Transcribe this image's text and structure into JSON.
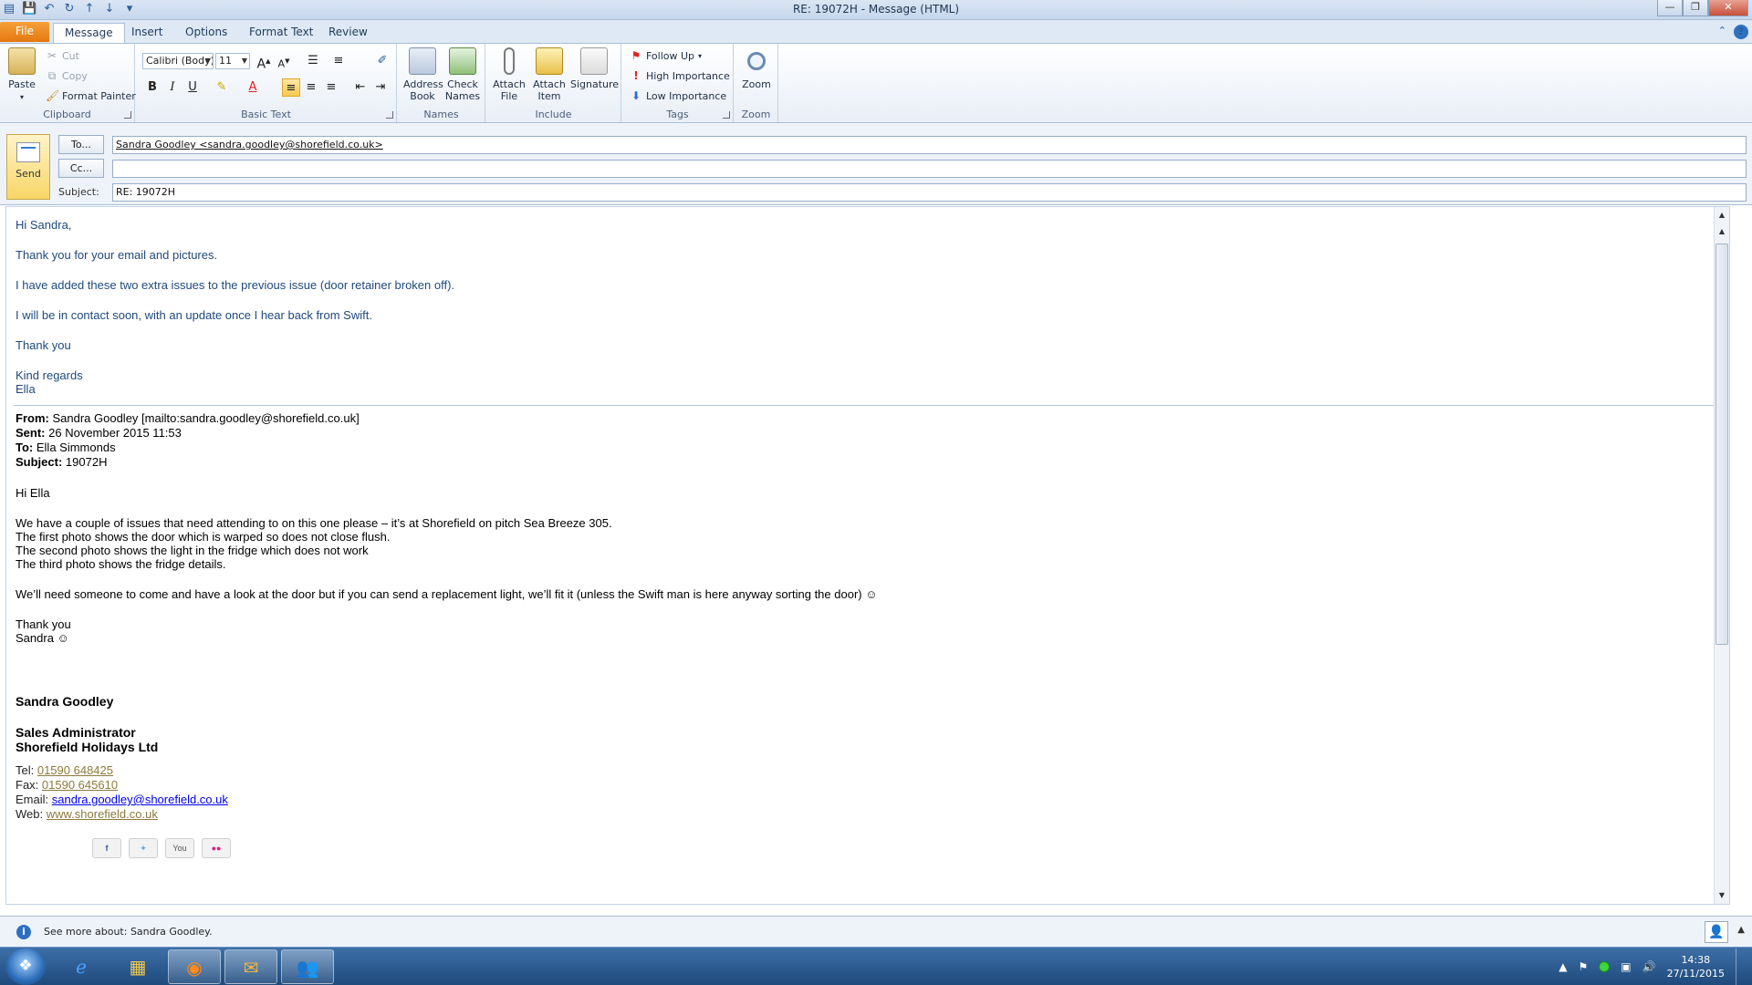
{
  "window": {
    "title": "RE: 19072H - Message (HTML)"
  },
  "tabs": [
    {
      "label": "File"
    },
    {
      "label": "Message"
    },
    {
      "label": "Insert"
    },
    {
      "label": "Options"
    },
    {
      "label": "Format Text"
    },
    {
      "label": "Review"
    }
  ],
  "ribbon": {
    "clipboard": {
      "label": "Clipboard",
      "paste": "Paste",
      "cut": "Cut",
      "copy": "Copy",
      "format_painter": "Format Painter"
    },
    "basic_text": {
      "label": "Basic Text",
      "font": "Calibri (Body)",
      "size": "11"
    },
    "names": {
      "label": "Names",
      "address_book": "Address Book",
      "check_names": "Check Names"
    },
    "include": {
      "label": "Include",
      "attach_file": "Attach File",
      "attach_item": "Attach Item",
      "signature": "Signature"
    },
    "tags": {
      "label": "Tags",
      "follow_up": "Follow Up",
      "high": "High Importance",
      "low": "Low Importance"
    },
    "zoom": {
      "label": "Zoom",
      "zoom": "Zoom"
    }
  },
  "compose": {
    "send": "Send",
    "to_btn": "To...",
    "cc_btn": "Cc...",
    "subject_lbl": "Subject:",
    "to_value": "Sandra Goodley <sandra.goodley@shorefield.co.uk>",
    "cc_value": "",
    "subject_value": "RE: 19072H"
  },
  "reply": {
    "greeting": "Hi Sandra,",
    "l1": "Thank you for your email and pictures.",
    "l2": "I have added these two extra issues to the previous issue (door retainer broken off).",
    "l3": "I will be in contact soon, with an update once I hear back from Swift.",
    "l4": "Thank you",
    "regards": "Kind regards",
    "name": "Ella"
  },
  "original": {
    "from_lbl": "From:",
    "from": "Sandra Goodley [mailto:sandra.goodley@shorefield.co.uk]",
    "sent_lbl": "Sent:",
    "sent": "26 November 2015 11:53",
    "to_lbl": "To:",
    "to": "Ella Simmonds",
    "subject_lbl": "Subject:",
    "subject": "19072H",
    "greeting": "Hi Ella",
    "p1": "We have a couple of issues that need attending to on this one please – it’s at Shorefield on pitch Sea Breeze 305.",
    "p2": "The first photo shows the door which is warped so does not close flush.",
    "p3": "The second photo shows the light in the fridge which does not work",
    "p4": "The third photo shows the fridge details.",
    "p5": "We’ll need someone to come and have a look at the door but if you can send a replacement light, we’ll fit it (unless the Swift man is here anyway sorting the door) ☺",
    "thanks": "Thank you",
    "sign": "Sandra ☺"
  },
  "signature": {
    "name": "Sandra Goodley",
    "title": "Sales Administrator",
    "company": "Shorefield Holidays Ltd",
    "tel_lbl": "Tel: ",
    "tel": "01590 648425",
    "fax_lbl": "Fax: ",
    "fax": "01590 645610",
    "email_lbl": "Email: ",
    "email": "sandra.goodley@shorefield.co.uk",
    "web_lbl": "Web: ",
    "web": "www.shorefield.co.uk",
    "youtube": "You"
  },
  "people_pane": {
    "text": "See more about: Sandra Goodley."
  },
  "taskbar": {
    "time": "14:38",
    "date": "27/11/2015"
  }
}
